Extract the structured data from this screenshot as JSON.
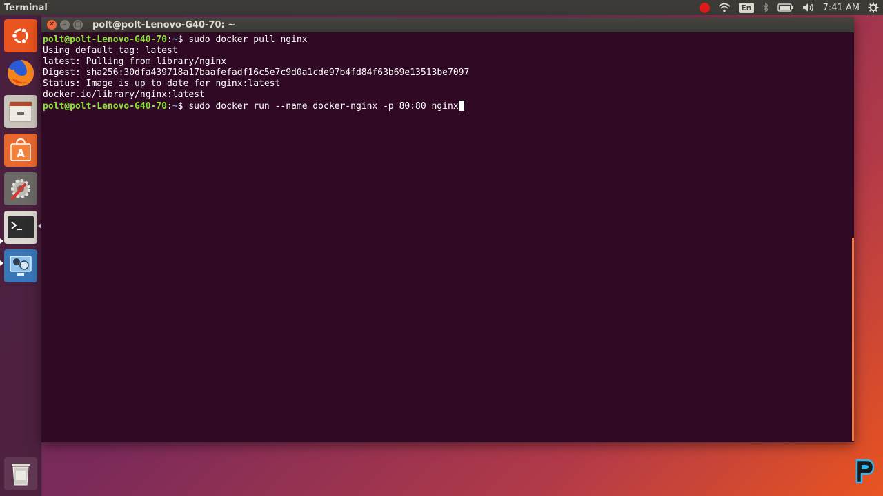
{
  "top_panel": {
    "app_name": "Terminal",
    "keyboard_layout": "En",
    "time": "7:41 AM",
    "icons": [
      "record-indicator-icon",
      "wifi-icon",
      "keyboard-layout-icon",
      "bluetooth-icon",
      "battery-icon",
      "volume-icon",
      "settings-gear-icon"
    ]
  },
  "launcher": {
    "items": [
      {
        "name": "ubuntu-dash-icon"
      },
      {
        "name": "firefox-icon"
      },
      {
        "name": "files-icon"
      },
      {
        "name": "software-center-icon"
      },
      {
        "name": "system-settings-icon"
      },
      {
        "name": "terminal-icon",
        "active": true
      },
      {
        "name": "screenshot-tool-icon"
      },
      {
        "name": "trash-icon"
      }
    ]
  },
  "window": {
    "title": "polt@polt-Lenovo-G40-70: ~",
    "close_glyph": "✕",
    "min_glyph": "–",
    "max_glyph": "□"
  },
  "terminal": {
    "lines": [
      {
        "user": "polt@polt-Lenovo-G40-70",
        "path": "~",
        "sym": "$ ",
        "cmd": "sudo docker pull nginx"
      },
      {
        "text": "Using default tag: latest"
      },
      {
        "text": "latest: Pulling from library/nginx"
      },
      {
        "text": "Digest: sha256:30dfa439718a17baafefadf16c5e7c9d0a1cde97b4fd84f63b69e13513be7097"
      },
      {
        "text": "Status: Image is up to date for nginx:latest"
      },
      {
        "text": "docker.io/library/nginx:latest"
      },
      {
        "user": "polt@polt-Lenovo-G40-70",
        "path": "~",
        "sym": "$ ",
        "cmd": "sudo docker run --name docker-nginx -p 80:80 nginx"
      }
    ]
  },
  "colors": {
    "terminal_bg": "#300a24",
    "prompt_user": "#8ae234",
    "prompt_path": "#729fcf",
    "accent": "#e95420"
  }
}
